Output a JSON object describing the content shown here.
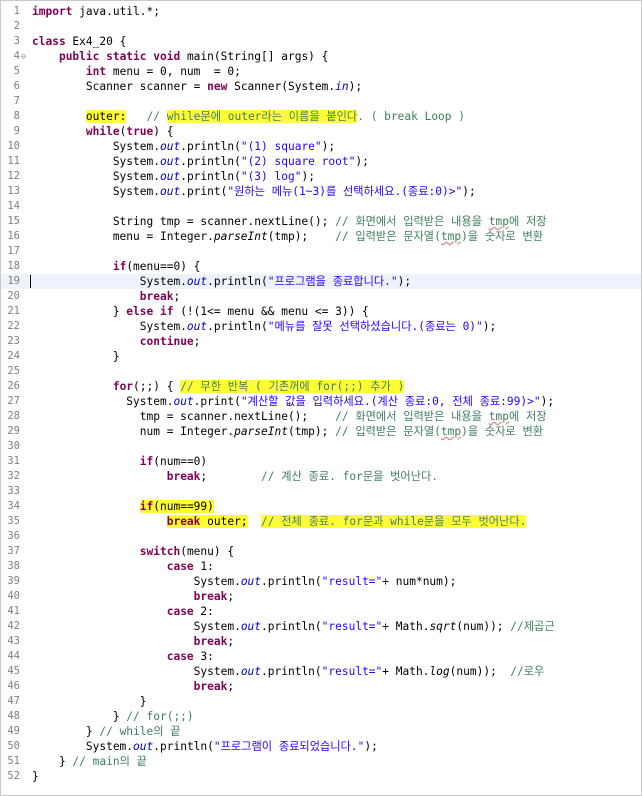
{
  "editor": {
    "language": "java",
    "current_line": 19,
    "highlight_color": "#ffff33",
    "fold_marker": "⊖",
    "lines": [
      {
        "n": "1",
        "t": [
          {
            "c": "kw",
            "v": "import"
          },
          {
            "v": " java.util.*;"
          }
        ]
      },
      {
        "n": "2",
        "t": []
      },
      {
        "n": "3",
        "t": [
          {
            "c": "kw",
            "v": "class"
          },
          {
            "v": " Ex4_20 {"
          }
        ]
      },
      {
        "n": "4",
        "fold": true,
        "t": [
          {
            "v": "    "
          },
          {
            "c": "kw",
            "v": "public static void"
          },
          {
            "v": " main(String[] args) {"
          }
        ]
      },
      {
        "n": "5",
        "t": [
          {
            "v": "        "
          },
          {
            "c": "kw",
            "v": "int"
          },
          {
            "v": " menu = 0, num  = 0;"
          }
        ]
      },
      {
        "n": "6",
        "t": [
          {
            "v": "        Scanner scanner = "
          },
          {
            "c": "kw",
            "v": "new"
          },
          {
            "v": " Scanner(System."
          },
          {
            "c": "fld",
            "v": "in"
          },
          {
            "v": ");"
          }
        ]
      },
      {
        "n": "7",
        "t": []
      },
      {
        "n": "8",
        "t": [
          {
            "v": "        "
          },
          {
            "c": "lbl hl",
            "v": "outer:"
          },
          {
            "c": "cmt",
            "v": "   // "
          },
          {
            "c": "cmt hl",
            "v": "while문에 outer라는 이름을 붙인다"
          },
          {
            "c": "cmt",
            "v": ". ( break Loop )"
          }
        ]
      },
      {
        "n": "9",
        "t": [
          {
            "v": "        "
          },
          {
            "c": "kw",
            "v": "while"
          },
          {
            "v": "("
          },
          {
            "c": "kw",
            "v": "true"
          },
          {
            "v": ") {"
          }
        ]
      },
      {
        "n": "10",
        "t": [
          {
            "v": "            System."
          },
          {
            "c": "fld",
            "v": "out"
          },
          {
            "v": ".println("
          },
          {
            "c": "str",
            "v": "\"(1) square\""
          },
          {
            "v": ");"
          }
        ]
      },
      {
        "n": "11",
        "t": [
          {
            "v": "            System."
          },
          {
            "c": "fld",
            "v": "out"
          },
          {
            "v": ".println("
          },
          {
            "c": "str",
            "v": "\"(2) square root\""
          },
          {
            "v": ");"
          }
        ]
      },
      {
        "n": "12",
        "t": [
          {
            "v": "            System."
          },
          {
            "c": "fld",
            "v": "out"
          },
          {
            "v": ".println("
          },
          {
            "c": "str",
            "v": "\"(3) log\""
          },
          {
            "v": ");"
          }
        ]
      },
      {
        "n": "13",
        "t": [
          {
            "v": "            System."
          },
          {
            "c": "fld",
            "v": "out"
          },
          {
            "v": ".print("
          },
          {
            "c": "str",
            "v": "\"원하는 메뉴(1~3)를 선택하세요.(종료:0)>\""
          },
          {
            "v": ");"
          }
        ]
      },
      {
        "n": "14",
        "t": []
      },
      {
        "n": "15",
        "t": [
          {
            "v": "            String tmp = scanner.nextLine(); "
          },
          {
            "c": "cmt",
            "v": "// 화면에서 입력받은 내용을 "
          },
          {
            "c": "cmt sq",
            "v": "tmp"
          },
          {
            "c": "cmt",
            "v": "에 저장"
          }
        ]
      },
      {
        "n": "16",
        "t": [
          {
            "v": "            menu = Integer."
          },
          {
            "c": "sm",
            "v": "parseInt"
          },
          {
            "v": "(tmp);    "
          },
          {
            "c": "cmt",
            "v": "// 입력받은 문자열("
          },
          {
            "c": "cmt sq",
            "v": "tmp"
          },
          {
            "c": "cmt",
            "v": ")을 숫자로 변환"
          }
        ]
      },
      {
        "n": "17",
        "t": []
      },
      {
        "n": "18",
        "t": [
          {
            "v": "            "
          },
          {
            "c": "kw",
            "v": "if"
          },
          {
            "v": "(menu==0) {"
          }
        ]
      },
      {
        "n": "19",
        "t": [
          {
            "v": "                System."
          },
          {
            "c": "fld",
            "v": "out"
          },
          {
            "v": ".println("
          },
          {
            "c": "str",
            "v": "\"프로그램을 종료합니다.\""
          },
          {
            "v": ");"
          }
        ]
      },
      {
        "n": "20",
        "t": [
          {
            "v": "                "
          },
          {
            "c": "kw",
            "v": "break"
          },
          {
            "v": ";"
          }
        ]
      },
      {
        "n": "21",
        "t": [
          {
            "v": "            } "
          },
          {
            "c": "kw",
            "v": "else if"
          },
          {
            "v": " (!(1<= menu && menu <= 3)) {"
          }
        ]
      },
      {
        "n": "22",
        "t": [
          {
            "v": "                System."
          },
          {
            "c": "fld",
            "v": "out"
          },
          {
            "v": ".println("
          },
          {
            "c": "str",
            "v": "\"메뉴를 잘못 선택하셨습니다.(종료는 0)\""
          },
          {
            "v": ");"
          }
        ]
      },
      {
        "n": "23",
        "t": [
          {
            "v": "                "
          },
          {
            "c": "kw",
            "v": "continue"
          },
          {
            "v": ";"
          }
        ]
      },
      {
        "n": "24",
        "t": [
          {
            "v": "            }"
          }
        ]
      },
      {
        "n": "25",
        "t": []
      },
      {
        "n": "26",
        "t": [
          {
            "v": "            "
          },
          {
            "c": "kw",
            "v": "for"
          },
          {
            "v": "(;;) { "
          },
          {
            "c": "cmt hl",
            "v": "// 무한 반복 ( 기존꺼에 for(;;) 추가 )"
          }
        ]
      },
      {
        "n": "27",
        "t": [
          {
            "v": "              System."
          },
          {
            "c": "fld",
            "v": "out"
          },
          {
            "v": ".print("
          },
          {
            "c": "str",
            "v": "\"계산할 값을 입력하세요.(계산 종료:0, 전체 종료:99)>\""
          },
          {
            "v": ");"
          }
        ]
      },
      {
        "n": "28",
        "t": [
          {
            "v": "                tmp = scanner.nextLine();    "
          },
          {
            "c": "cmt",
            "v": "// 화면에서 입력받은 내용을 "
          },
          {
            "c": "cmt sq",
            "v": "tmp"
          },
          {
            "c": "cmt",
            "v": "에 저장"
          }
        ]
      },
      {
        "n": "29",
        "t": [
          {
            "v": "                num = Integer."
          },
          {
            "c": "sm",
            "v": "parseInt"
          },
          {
            "v": "(tmp); "
          },
          {
            "c": "cmt",
            "v": "// 입력받은 문자열("
          },
          {
            "c": "cmt sq",
            "v": "tmp"
          },
          {
            "c": "cmt",
            "v": ")을 숫자로 변환"
          }
        ]
      },
      {
        "n": "30",
        "t": []
      },
      {
        "n": "31",
        "t": [
          {
            "v": "                "
          },
          {
            "c": "kw",
            "v": "if"
          },
          {
            "v": "(num==0)"
          }
        ]
      },
      {
        "n": "32",
        "t": [
          {
            "v": "                    "
          },
          {
            "c": "kw",
            "v": "break"
          },
          {
            "v": ";        "
          },
          {
            "c": "cmt",
            "v": "// 계산 종료. for문을 벗어난다."
          }
        ]
      },
      {
        "n": "33",
        "t": []
      },
      {
        "n": "34",
        "t": [
          {
            "v": "                "
          },
          {
            "c": "kw hl",
            "v": "if"
          },
          {
            "c": "hl",
            "v": "(num==99)"
          }
        ]
      },
      {
        "n": "35",
        "t": [
          {
            "v": "                    "
          },
          {
            "c": "kw hl",
            "v": "break"
          },
          {
            "c": "hl",
            "v": " outer;"
          },
          {
            "v": "  "
          },
          {
            "c": "cmt hl",
            "v": "// 전체 종료. for문과 while문을 모두 벗어난다."
          }
        ]
      },
      {
        "n": "36",
        "t": []
      },
      {
        "n": "37",
        "t": [
          {
            "v": "                "
          },
          {
            "c": "kw",
            "v": "switch"
          },
          {
            "v": "(menu) {"
          }
        ]
      },
      {
        "n": "38",
        "t": [
          {
            "v": "                    "
          },
          {
            "c": "kw",
            "v": "case"
          },
          {
            "v": " 1:"
          }
        ]
      },
      {
        "n": "39",
        "t": [
          {
            "v": "                        System."
          },
          {
            "c": "fld",
            "v": "out"
          },
          {
            "v": ".println("
          },
          {
            "c": "str",
            "v": "\"result=\""
          },
          {
            "v": "+ num*num);"
          }
        ]
      },
      {
        "n": "40",
        "t": [
          {
            "v": "                        "
          },
          {
            "c": "kw",
            "v": "break"
          },
          {
            "v": ";"
          }
        ]
      },
      {
        "n": "41",
        "t": [
          {
            "v": "                    "
          },
          {
            "c": "kw",
            "v": "case"
          },
          {
            "v": " 2:"
          }
        ]
      },
      {
        "n": "42",
        "t": [
          {
            "v": "                        System."
          },
          {
            "c": "fld",
            "v": "out"
          },
          {
            "v": ".println("
          },
          {
            "c": "str",
            "v": "\"result=\""
          },
          {
            "v": "+ Math."
          },
          {
            "c": "sm",
            "v": "sqrt"
          },
          {
            "v": "(num)); "
          },
          {
            "c": "cmt",
            "v": "//제곱근"
          }
        ]
      },
      {
        "n": "43",
        "t": [
          {
            "v": "                        "
          },
          {
            "c": "kw",
            "v": "break"
          },
          {
            "v": ";"
          }
        ]
      },
      {
        "n": "44",
        "t": [
          {
            "v": "                    "
          },
          {
            "c": "kw",
            "v": "case"
          },
          {
            "v": " 3:"
          }
        ]
      },
      {
        "n": "45",
        "t": [
          {
            "v": "                        System."
          },
          {
            "c": "fld",
            "v": "out"
          },
          {
            "v": ".println("
          },
          {
            "c": "str",
            "v": "\"result=\""
          },
          {
            "v": "+ Math."
          },
          {
            "c": "sm",
            "v": "log"
          },
          {
            "v": "(num));  "
          },
          {
            "c": "cmt",
            "v": "//로우"
          }
        ]
      },
      {
        "n": "46",
        "t": [
          {
            "v": "                        "
          },
          {
            "c": "kw",
            "v": "break"
          },
          {
            "v": ";"
          }
        ]
      },
      {
        "n": "47",
        "t": [
          {
            "v": "                }"
          }
        ]
      },
      {
        "n": "48",
        "t": [
          {
            "v": "            } "
          },
          {
            "c": "cmt",
            "v": "// for(;;)"
          }
        ]
      },
      {
        "n": "49",
        "t": [
          {
            "v": "        } "
          },
          {
            "c": "cmt",
            "v": "// while의 끝"
          }
        ]
      },
      {
        "n": "50",
        "t": [
          {
            "v": "        System."
          },
          {
            "c": "fld",
            "v": "out"
          },
          {
            "v": ".println("
          },
          {
            "c": "str",
            "v": "\"프로그램이 종료되었습니다.\""
          },
          {
            "v": ");"
          }
        ]
      },
      {
        "n": "51",
        "t": [
          {
            "v": "    } "
          },
          {
            "c": "cmt",
            "v": "// main의 끝"
          }
        ]
      },
      {
        "n": "52",
        "t": [
          {
            "v": "}"
          }
        ]
      }
    ]
  }
}
